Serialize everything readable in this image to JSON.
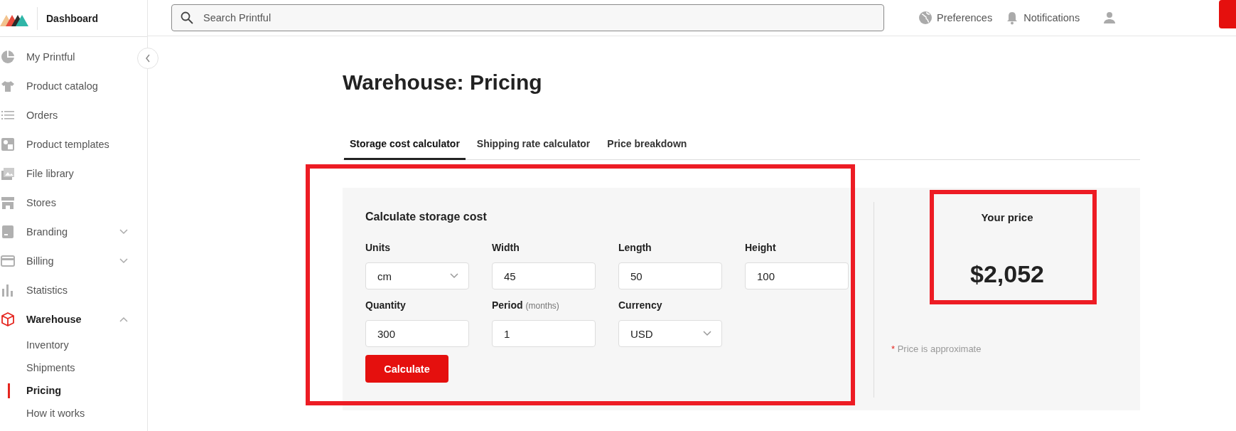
{
  "sidebar": {
    "title": "Dashboard",
    "items": [
      {
        "label": "My Printful",
        "selected": false
      },
      {
        "label": "Product catalog",
        "selected": false
      },
      {
        "label": "Orders",
        "selected": false
      },
      {
        "label": "Product templates",
        "selected": false
      },
      {
        "label": "File library",
        "selected": false
      },
      {
        "label": "Stores",
        "selected": false
      },
      {
        "label": "Branding",
        "selected": false,
        "expanded": false
      },
      {
        "label": "Billing",
        "selected": false,
        "expanded": false
      },
      {
        "label": "Statistics",
        "selected": false
      },
      {
        "label": "Warehouse",
        "selected": true,
        "expanded": true,
        "children": [
          {
            "label": "Inventory",
            "selected": false
          },
          {
            "label": "Shipments",
            "selected": false
          },
          {
            "label": "Pricing",
            "selected": true
          },
          {
            "label": "How it works",
            "selected": false
          }
        ]
      }
    ]
  },
  "topbar": {
    "search": {
      "placeholder": "Search Printful"
    },
    "links": [
      "Preferences",
      "Notifications"
    ]
  },
  "page": {
    "title": "Warehouse: Pricing",
    "tabs": [
      {
        "label": "Storage cost calculator",
        "selected": true
      },
      {
        "label": "Shipping rate calculator",
        "selected": false
      },
      {
        "label": "Price breakdown",
        "selected": false
      }
    ],
    "form": {
      "title": "Calculate storage cost",
      "fields": [
        {
          "kind": "select",
          "label": "Units",
          "value": "cm"
        },
        {
          "kind": "input",
          "label": "Width",
          "value": "45"
        },
        {
          "kind": "input",
          "label": "Length",
          "value": "50"
        },
        {
          "kind": "input",
          "label": "Height",
          "value": "100"
        },
        {
          "kind": "input",
          "label": "Quantity",
          "value": "300"
        },
        {
          "kind": "input",
          "label": "Period",
          "hint": "(months)",
          "value": "1"
        },
        {
          "kind": "select",
          "label": "Currency",
          "value": "USD"
        }
      ],
      "button": "Calculate"
    },
    "result": {
      "label": "Your price",
      "value": "$2,052",
      "note_mark": "*",
      "note": "Price is approximate"
    }
  }
}
